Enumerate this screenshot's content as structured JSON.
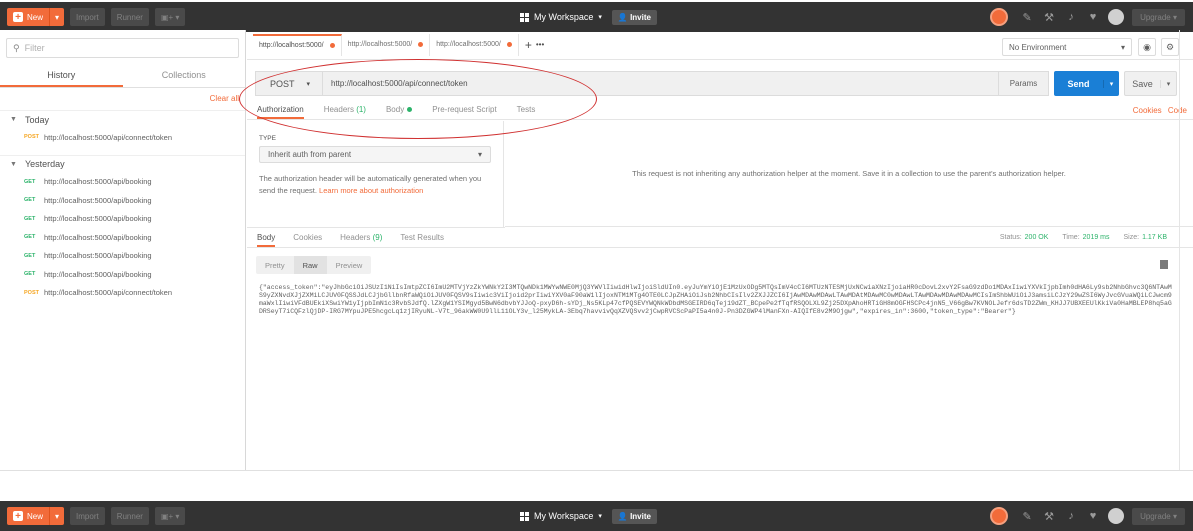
{
  "topbar": {
    "new_label": "New",
    "import_label": "Import",
    "runner_label": "Runner",
    "workspace_label": "My Workspace",
    "invite_label": "Invite",
    "upgrade_label": "Upgrade"
  },
  "sidebar": {
    "filter_placeholder": "Filter",
    "tabs": [
      "History",
      "Collections"
    ],
    "clear_all": "Clear all",
    "today_label": "Today",
    "yesterday_label": "Yesterday",
    "today_items": [
      {
        "method": "POST",
        "url": "http://localhost:5000/api/connect/token"
      }
    ],
    "yesterday_items": [
      {
        "method": "GET",
        "url": "http://localhost:5000/api/booking"
      },
      {
        "method": "GET",
        "url": "http://localhost:5000/api/booking"
      },
      {
        "method": "GET",
        "url": "http://localhost:5000/api/booking"
      },
      {
        "method": "GET",
        "url": "http://localhost:5000/api/booking"
      },
      {
        "method": "GET",
        "url": "http://localhost:5000/api/booking"
      },
      {
        "method": "GET",
        "url": "http://localhost:5000/api/booking"
      },
      {
        "method": "POST",
        "url": "http://localhost:5000/api/connect/token"
      }
    ]
  },
  "request_tabs": [
    "http://localhost:5000/",
    "http://localhost:5000/",
    "http://localhost:5000/"
  ],
  "environment": "No Environment",
  "request": {
    "method": "POST",
    "url": "http://localhost:5000/api/connect/token",
    "params_label": "Params",
    "send_label": "Send",
    "save_label": "Save",
    "tabs": {
      "authorization": "Authorization",
      "headers": "Headers",
      "headers_count": "(1)",
      "body": "Body",
      "prerequest": "Pre-request Script",
      "tests": "Tests"
    },
    "cookies": "Cookies",
    "code": "Code"
  },
  "auth": {
    "type_label": "TYPE",
    "type_value": "Inherit auth from parent",
    "help_text": "The authorization header will be automatically generated when you send the request. ",
    "help_link": "Learn more about authorization",
    "right_message": "This request is not inheriting any authorization helper at the moment. Save it in a collection to use the parent's authorization helper."
  },
  "response": {
    "tabs": {
      "body": "Body",
      "cookies": "Cookies",
      "headers": "Headers",
      "headers_count": "(9)",
      "test_results": "Test Results"
    },
    "status_label": "Status:",
    "status_value": "200 OK",
    "time_label": "Time:",
    "time_value": "2019 ms",
    "size_label": "Size:",
    "size_value": "1.17 KB",
    "view_modes": [
      "Pretty",
      "Raw",
      "Preview"
    ],
    "body_text": "{\"access_token\":\"eyJhbGciOiJSUzI1NiIsImtpZCI6ImU2MTVjYzZkYWNkY2I3MTQwNDk1MWYwNWE0MjQ3YWVlIiwidHlwIjoiSldUIn0.eyJuYmYiOjE1MzUxODg5MTQsImV4cCI6MTUzNTESMjUxNCwiaXNzIjoiaHR0cDovL2xvY2FsaG9zdDo1MDAxIiwiYXVkIjpbImh0dHA6Ly9sb2NhbGhvc3Q6NTAwMS9yZXNvdXJjZXMiLCJUV0FQSSJdLCJjbGllbnRfaWQiOiJUV0FQSV9sIiwic3ViIjoid2prIiwiYXV0aF90aW1lIjoxNTM1MTg4OTE0LCJpZHAiOiJsb2NhbCIsIlv2ZXJJZCI6IjAwMDAwMDAwLTAwMDAtMDAwMC0wMDAwLTAwMDAwMDAwMDAwMCIsImShbWUiOiJ3amsiLCJzY29wZSI6WyJvcGVuaWQiLCJwcm9maWxlIiwiVFdBUEkiXSwiYW1yIjpbImN1c3RvbSJdfQ.lZXgW1YSIMgyd5BwN6dbvbYJJoQ-pxyD6h-sYDj_Ns5KLp47cfPQSEVYWQNkWDbdMSGEIRD6qTej19dZT_BCpePe2fTqfRSQOLXL9Zj25DXpAhoHRTiGH8mOGFHSCPc4jnN5_V66gBw7KVNOLJefr6dsTD2ZWm_KHJJ7UBXEEUlKkiVa0HaMBLEP8hq5aGDRSeyT7iCQFzlQjDP-IRG7MYpuJPE5hcgcLq1zjIRyuNL-V7t_96akWW0U9llL11OLY3v_l25MykLA-3Ebq7havvivQqXZVQSvv2jCwpRVCScPaPI5a4n0J-Pn3DZGWP4lManFXn-AIQIfE8v2M9Ojgw\",\"expires_in\":3600,\"token_type\":\"Bearer\"}"
  }
}
